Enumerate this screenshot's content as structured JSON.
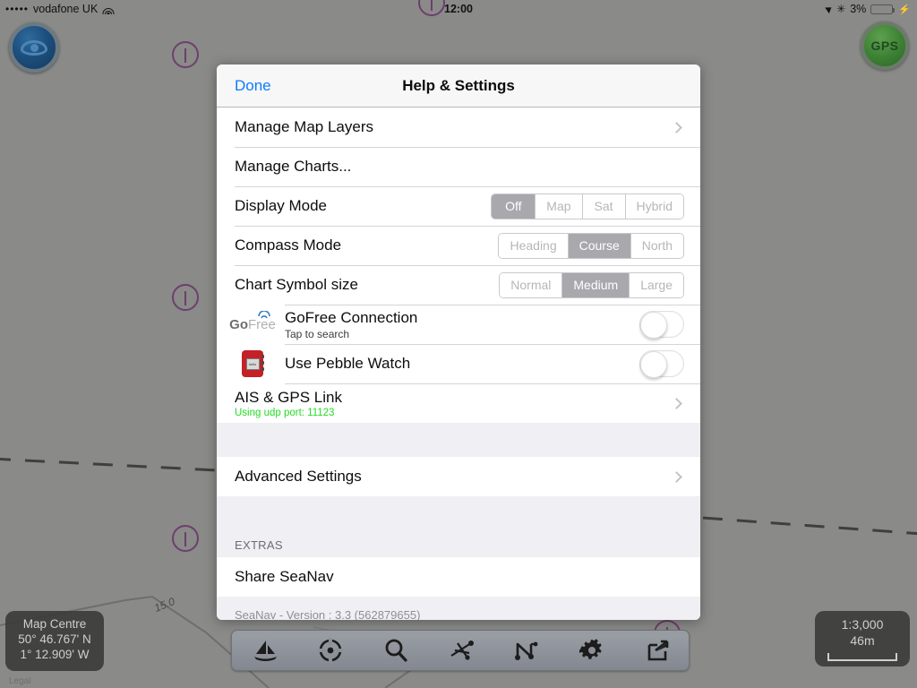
{
  "status_bar": {
    "signal_dots": "•••••",
    "carrier": "vodafone UK",
    "wifi_icon": "wifi-icon",
    "time": "12:00",
    "location_icon": "location-arrow-icon",
    "bluetooth_icon": "bluetooth-icon",
    "battery_percent": "3%",
    "charging_icon": "lightning-bolt-icon"
  },
  "map": {
    "eye_button": {
      "icon": "eye-icon",
      "label": ""
    },
    "gps_button": {
      "label": "GPS"
    },
    "hazard_icon": "warning-circle-icon",
    "depth_contour_label": "15.0",
    "legal_link": "Legal",
    "map_centre": {
      "title": "Map Centre",
      "latitude": "50° 46.767' N",
      "longitude": "1° 12.909' W"
    },
    "scale": {
      "ratio": "1:3,000",
      "distance": "46m"
    }
  },
  "toolbar": {
    "buttons": [
      {
        "name": "vessel-button",
        "icon": "sailboat-icon"
      },
      {
        "name": "center-on-location-button",
        "icon": "crosshair-icon"
      },
      {
        "name": "search-button",
        "icon": "search-icon"
      },
      {
        "name": "waypoint-button",
        "icon": "waypoint-icon"
      },
      {
        "name": "route-button",
        "icon": "route-icon"
      },
      {
        "name": "settings-button",
        "icon": "gear-icon"
      },
      {
        "name": "share-button",
        "icon": "share-icon"
      }
    ]
  },
  "modal": {
    "done_label": "Done",
    "title": "Help & Settings",
    "rows": {
      "manage_map_layers": "Manage Map Layers",
      "manage_charts": "Manage Charts...",
      "display_mode": "Display Mode",
      "compass_mode": "Compass Mode",
      "chart_symbol_size": "Chart Symbol size",
      "gofree_title": "GoFree Connection",
      "gofree_sub": "Tap to search",
      "gofree_logo_bold": "Go",
      "gofree_logo_light": "Free",
      "pebble_title": "Use Pebble Watch",
      "ais_gps_title": "AIS & GPS Link",
      "ais_gps_sub": "Using udp port: 11123",
      "advanced_settings": "Advanced Settings",
      "extras_header": "EXTRAS",
      "share_seanav": "Share SeaNav",
      "version_note": "SeaNav - Version : 3.3 (562879655)"
    },
    "segments": {
      "display_mode": {
        "options": [
          "Off",
          "Map",
          "Sat",
          "Hybrid"
        ],
        "selected": "Off"
      },
      "compass_mode": {
        "options": [
          "Heading",
          "Course",
          "North"
        ],
        "selected": "Course"
      },
      "chart_symbol_size": {
        "options": [
          "Normal",
          "Medium",
          "Large"
        ],
        "selected": "Medium"
      }
    },
    "toggles": {
      "gofree_connection": "off",
      "pebble_watch": "off"
    }
  },
  "colors": {
    "accent_blue": "#0a7cff",
    "status_green": "#22dd22",
    "hazard_purple": "#6d3f6d",
    "battery_red": "#e03b28",
    "pebble_red": "#c42027"
  }
}
